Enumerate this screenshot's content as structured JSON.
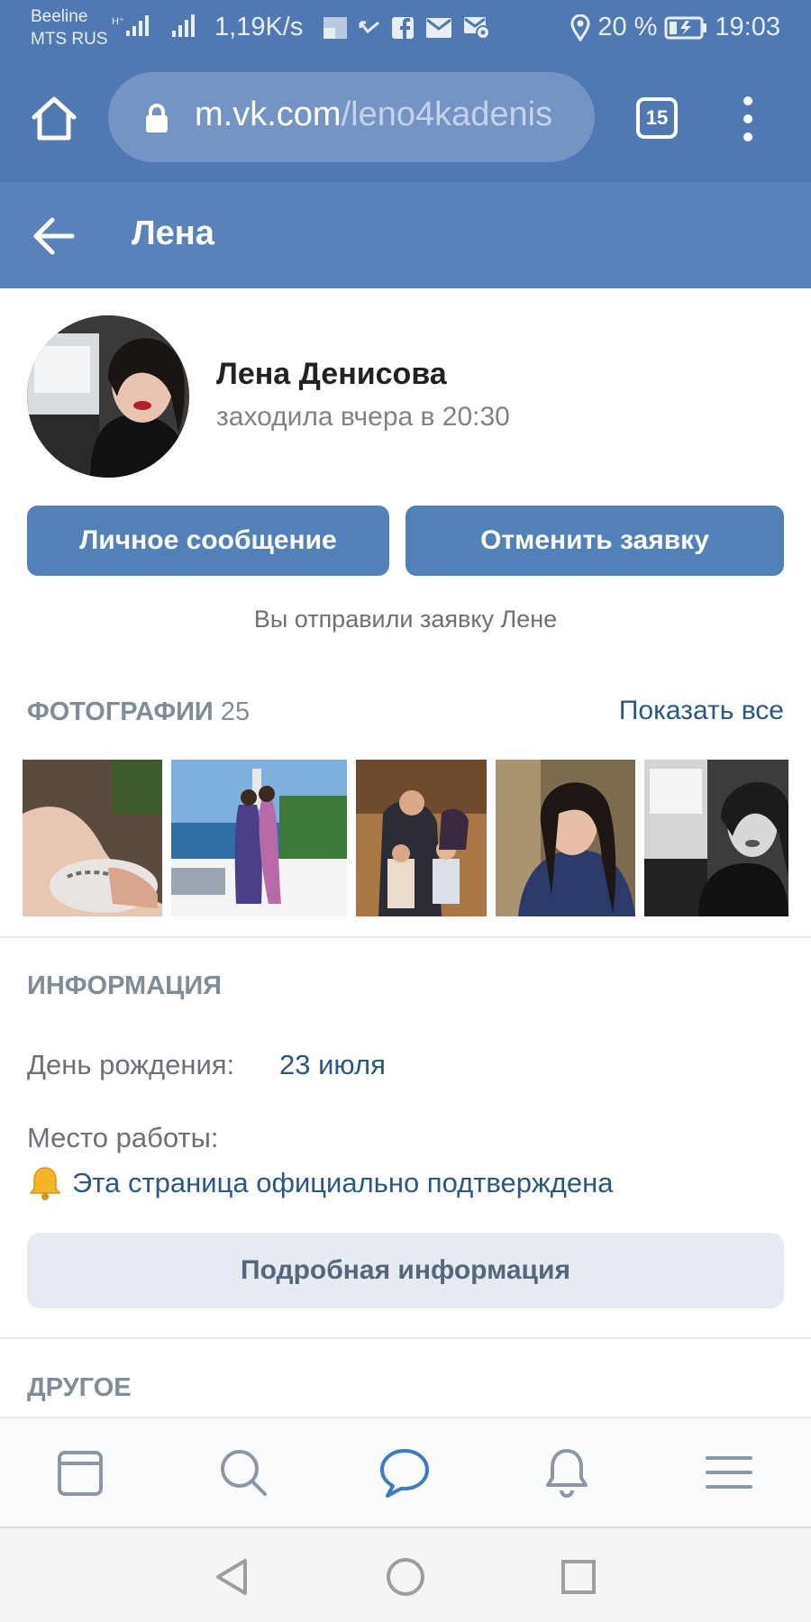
{
  "status_bar": {
    "carrier_1": "Beeline",
    "carrier_2": "MTS RUS",
    "net_speed": "1,19K/s",
    "battery": "20 %",
    "time": "19:03",
    "icons": [
      "signal-icon",
      "signal-icon",
      "gallery-icon",
      "missed-call-icon",
      "facebook-icon",
      "mail-icon",
      "mail-settings-icon",
      "location-icon",
      "battery-charging-icon"
    ]
  },
  "browser": {
    "url_domain": "m.vk.com",
    "url_path": "/leno4kadenis",
    "tab_count": "15"
  },
  "header": {
    "title": "Лена"
  },
  "profile": {
    "name": "Лена Денисова",
    "status": "заходила вчера в 20:30",
    "message_button": "Личное сообщение",
    "cancel_button": "Отменить заявку",
    "request_note": "Вы отправили заявку Лене"
  },
  "photos": {
    "title": "ФОТОГРАФИИ",
    "count": "25",
    "show_all": "Показать все"
  },
  "info": {
    "title": "ИНФОРМАЦИЯ",
    "birthday_label": "День рождения:",
    "birthday_value": "23 июля",
    "work_label": "Место работы:",
    "verified_text": "Эта страница официально подтверждена",
    "details_button": "Подробная информация"
  },
  "other": {
    "title": "ДРУГОЕ"
  },
  "bottom_nav": {
    "items": [
      "feed-icon",
      "search-icon",
      "messages-icon",
      "notifications-icon",
      "menu-icon"
    ],
    "active": "messages-icon"
  },
  "colors": {
    "header_blue": "#5a81b9",
    "browser_blue": "#5079b3",
    "button_blue": "#5181b8",
    "link_blue": "#2a5885",
    "secondary_text": "#818c99"
  }
}
